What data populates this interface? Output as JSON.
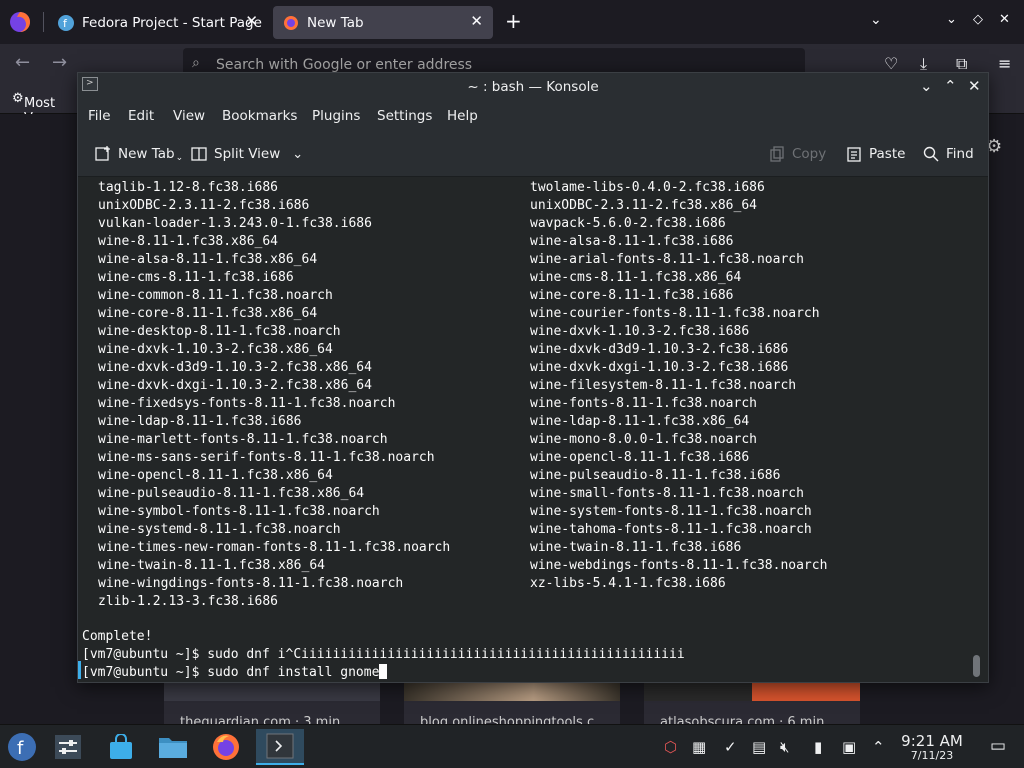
{
  "firefox": {
    "tabs": [
      {
        "title": "Fedora Project - Start Page"
      },
      {
        "title": "New Tab"
      }
    ],
    "address_placeholder": "Search with Google or enter address",
    "bookmarks_item": "Most V",
    "tiles": [
      {
        "caption": "theguardian.com · 3 min"
      },
      {
        "caption": "blog.onlineshoppingtools.c"
      },
      {
        "caption": "atlasobscura.com · 6 min"
      }
    ]
  },
  "konsole": {
    "title": "~ : bash — Konsole",
    "menu": [
      "File",
      "Edit",
      "View",
      "Bookmarks",
      "Plugins",
      "Settings",
      "Help"
    ],
    "toolbar": {
      "new_tab": "New Tab",
      "split_view": "Split View",
      "copy": "Copy",
      "paste": "Paste",
      "find": "Find"
    },
    "packages_left": [
      "taglib-1.12-8.fc38.i686",
      "unixODBC-2.3.11-2.fc38.i686",
      "vulkan-loader-1.3.243.0-1.fc38.i686",
      "wine-8.11-1.fc38.x86_64",
      "wine-alsa-8.11-1.fc38.x86_64",
      "wine-cms-8.11-1.fc38.i686",
      "wine-common-8.11-1.fc38.noarch",
      "wine-core-8.11-1.fc38.x86_64",
      "wine-desktop-8.11-1.fc38.noarch",
      "wine-dxvk-1.10.3-2.fc38.x86_64",
      "wine-dxvk-d3d9-1.10.3-2.fc38.x86_64",
      "wine-dxvk-dxgi-1.10.3-2.fc38.x86_64",
      "wine-fixedsys-fonts-8.11-1.fc38.noarch",
      "wine-ldap-8.11-1.fc38.i686",
      "wine-marlett-fonts-8.11-1.fc38.noarch",
      "wine-ms-sans-serif-fonts-8.11-1.fc38.noarch",
      "wine-opencl-8.11-1.fc38.x86_64",
      "wine-pulseaudio-8.11-1.fc38.x86_64",
      "wine-symbol-fonts-8.11-1.fc38.noarch",
      "wine-systemd-8.11-1.fc38.noarch",
      "wine-times-new-roman-fonts-8.11-1.fc38.noarch",
      "wine-twain-8.11-1.fc38.x86_64",
      "wine-wingdings-fonts-8.11-1.fc38.noarch",
      "zlib-1.2.13-3.fc38.i686"
    ],
    "packages_right": [
      "twolame-libs-0.4.0-2.fc38.i686",
      "unixODBC-2.3.11-2.fc38.x86_64",
      "wavpack-5.6.0-2.fc38.i686",
      "wine-alsa-8.11-1.fc38.i686",
      "wine-arial-fonts-8.11-1.fc38.noarch",
      "wine-cms-8.11-1.fc38.x86_64",
      "wine-core-8.11-1.fc38.i686",
      "wine-courier-fonts-8.11-1.fc38.noarch",
      "wine-dxvk-1.10.3-2.fc38.i686",
      "wine-dxvk-d3d9-1.10.3-2.fc38.i686",
      "wine-dxvk-dxgi-1.10.3-2.fc38.i686",
      "wine-filesystem-8.11-1.fc38.noarch",
      "wine-fonts-8.11-1.fc38.noarch",
      "wine-ldap-8.11-1.fc38.x86_64",
      "wine-mono-8.0.0-1.fc38.noarch",
      "wine-opencl-8.11-1.fc38.i686",
      "wine-pulseaudio-8.11-1.fc38.i686",
      "wine-small-fonts-8.11-1.fc38.noarch",
      "wine-system-fonts-8.11-1.fc38.noarch",
      "wine-tahoma-fonts-8.11-1.fc38.noarch",
      "wine-twain-8.11-1.fc38.i686",
      "wine-webdings-fonts-8.11-1.fc38.noarch",
      "xz-libs-5.4.1-1.fc38.i686"
    ],
    "complete": "Complete!",
    "prompt1": "[vm7@ubuntu ~]$ sudo dnf i^Ciiiiiiiiiiiiiiiiiiiiiiiiiiiiiiiiiiiiiiiiiiiiiiiii",
    "prompt2": "[vm7@ubuntu ~]$ sudo dnf install gnome"
  },
  "taskbar": {
    "time": "9:21 AM",
    "date": "7/11/23"
  },
  "colors": {
    "accent": "#3daee9",
    "terminal_bg": "#232627",
    "firefox_bg": "#1c1b22"
  }
}
